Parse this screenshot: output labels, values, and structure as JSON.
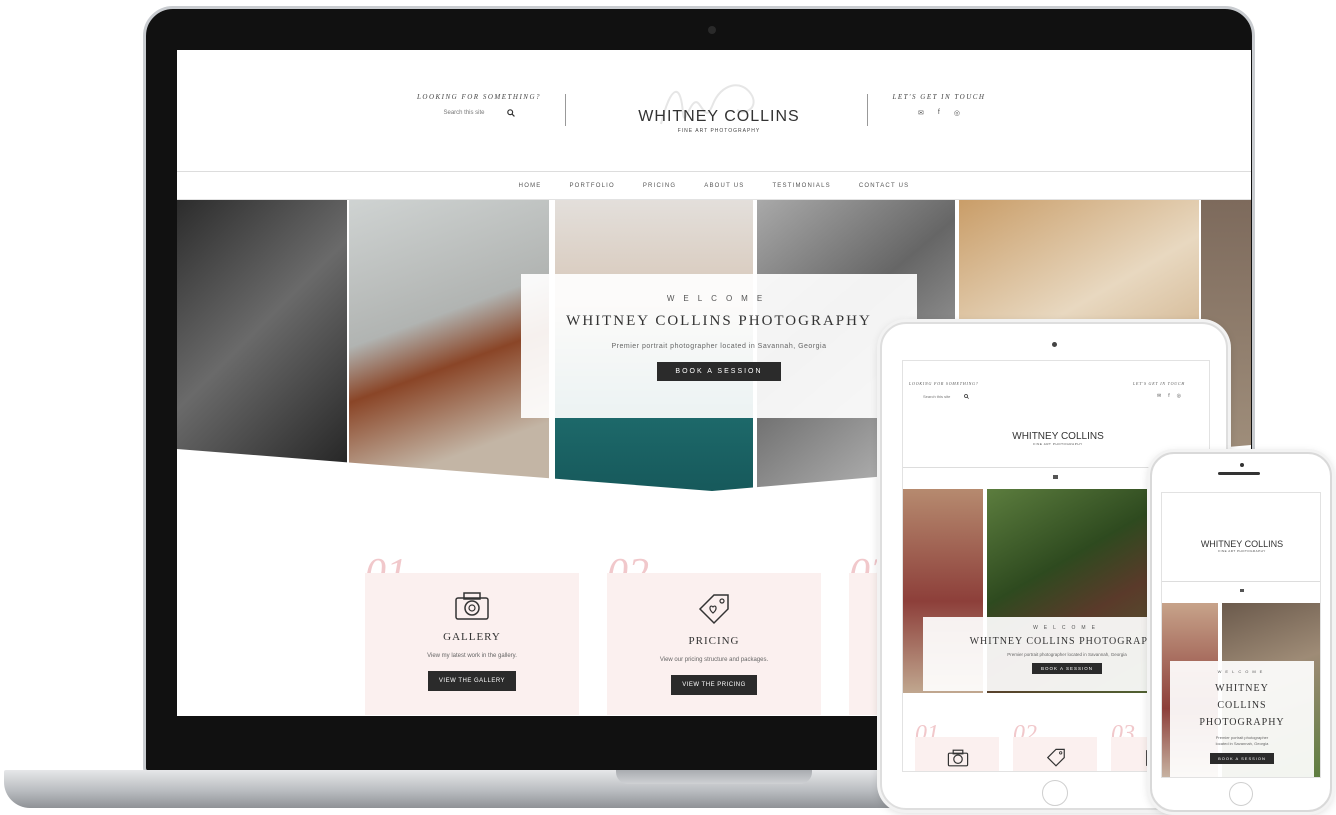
{
  "site": {
    "search_label": "LOOKING FOR SOMETHING?",
    "search_placeholder": "Search this site",
    "social_label": "LET'S GET IN TOUCH",
    "brand": "WHITNEY COLLINS",
    "brand_sub": "FINE ART PHOTOGRAPHY",
    "nav": [
      "HOME",
      "PORTFOLIO",
      "PRICING",
      "ABOUT US",
      "TESTIMONIALS",
      "CONTACT US"
    ]
  },
  "hero": {
    "kicker": "WELCOME",
    "title": "WHITNEY COLLINS PHOTOGRAPHY",
    "subtitle": "Premier portrait photographer located in Savannah, Georgia",
    "button": "BOOK A SESSION"
  },
  "services": [
    {
      "num": "01.",
      "title": "GALLERY",
      "text": "View my latest work in the gallery.",
      "button": "VIEW THE GALLERY",
      "icon": "camera-icon"
    },
    {
      "num": "02.",
      "title": "PRICING",
      "text": "View our pricing structure and packages.",
      "button": "VIEW THE PRICING",
      "icon": "tag-icon"
    },
    {
      "num": "03.",
      "icon": "frame-icon"
    }
  ],
  "phone_hero": {
    "title_1": "WHITNEY",
    "title_2": "COLLINS",
    "title_3": "PHOTOGRAPHY",
    "sub_1": "Premier portrait photographer",
    "sub_2": "located in Savannah, Georgia"
  },
  "colors": {
    "accent_pink": "#f1c8cb",
    "card_bg": "#fbf0ef",
    "button_dark": "#2b2b2b"
  }
}
